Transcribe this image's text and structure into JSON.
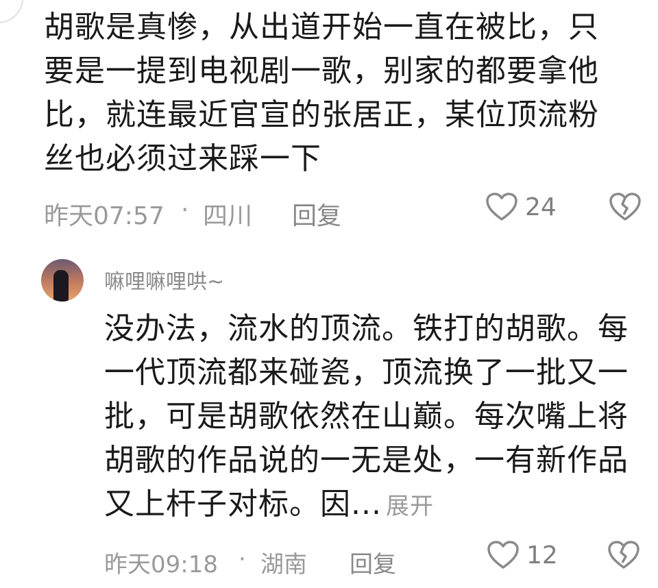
{
  "top_comment": {
    "lines": [
      "胡歌是真惨，从出道开始一直在被比，只",
      "要是一提到电视剧一歌，别家的都要拿他",
      "比，就连最近官宣的张居正，某位顶流粉",
      "丝也必须过来踩一下"
    ],
    "time": "昨天07:57",
    "separator": "·",
    "location": "四川",
    "reply_label": "回复",
    "likes": "24",
    "like_icon": "heart-outline-icon",
    "dislike_icon": "broken-heart-icon"
  },
  "reply": {
    "username": "嘛哩嘛哩哄~",
    "avatar_icon": "avatar",
    "lines": [
      "没办法，流水的顶流。铁打的胡歌。每",
      "一代顶流都来碰瓷，顶流换了一批又一",
      "批，可是胡歌依然在山巅。每次嘴上将",
      "胡歌的作品说的一无是处，一有新作品",
      "又上杆子对标。因..."
    ],
    "expand_label": "展开",
    "time": "昨天09:18",
    "separator": "·",
    "location": "湖南",
    "reply_label": "回复",
    "likes": "12"
  }
}
